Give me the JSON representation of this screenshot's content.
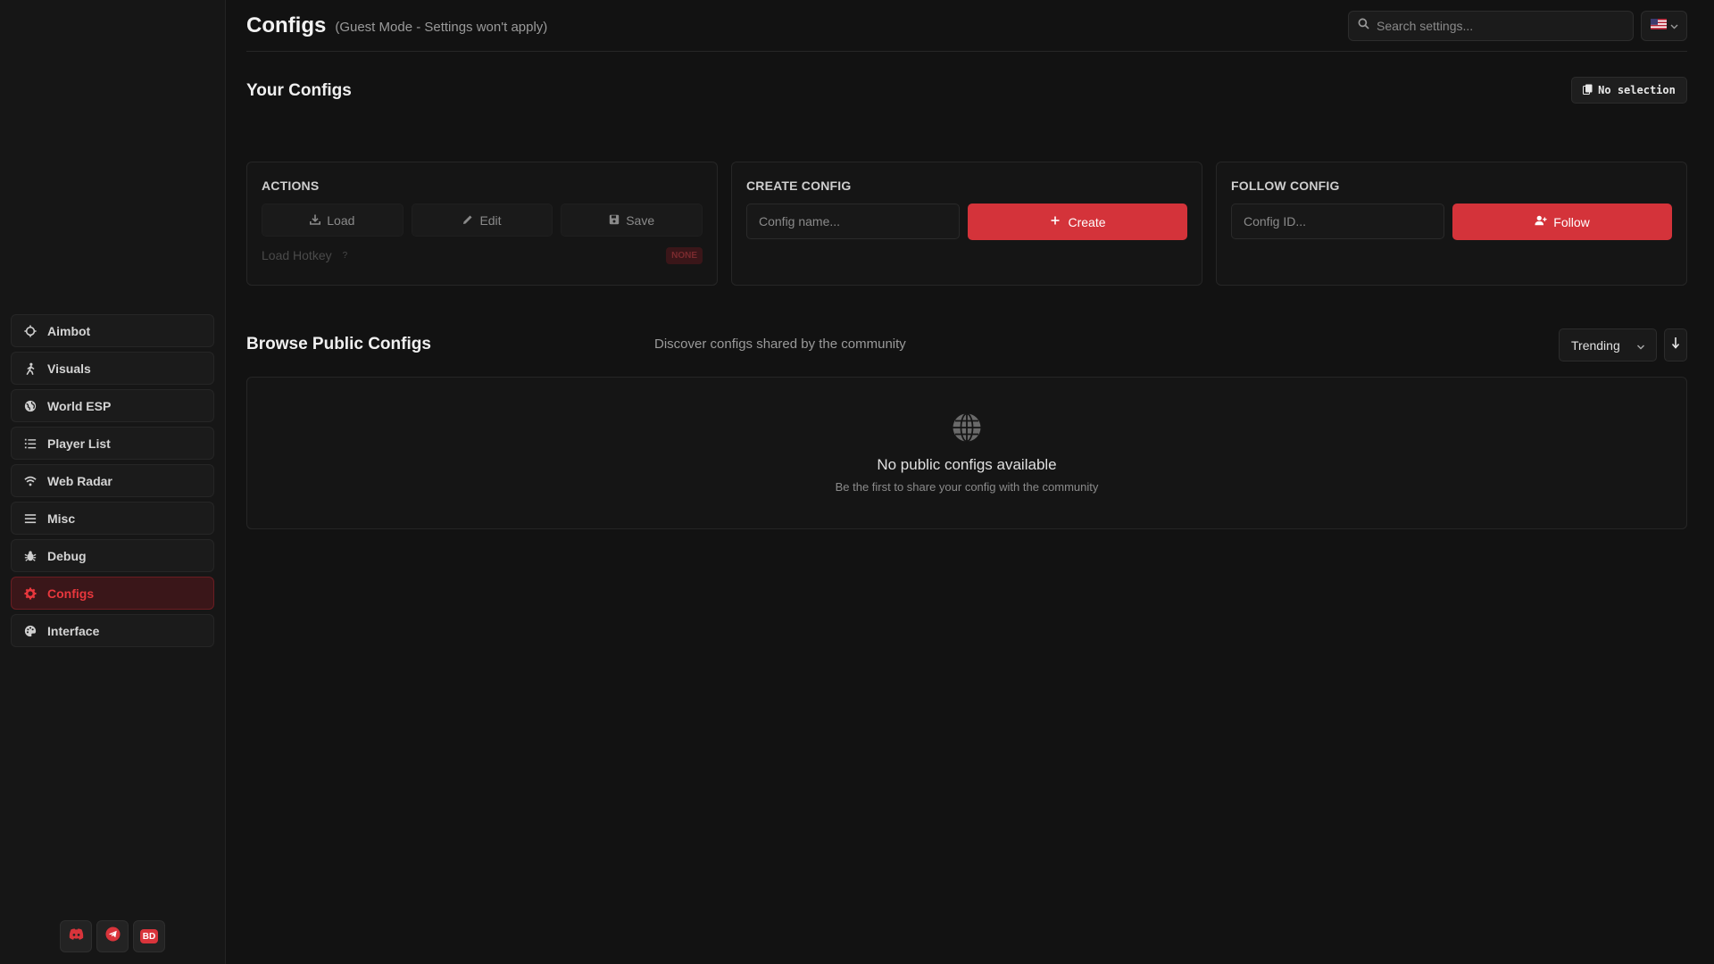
{
  "header": {
    "title": "Configs",
    "subtitle": "(Guest Mode - Settings won't apply)",
    "search_placeholder": "Search settings..."
  },
  "sidebar": {
    "items": [
      {
        "label": "Aimbot",
        "icon": "crosshair-icon",
        "active": false
      },
      {
        "label": "Visuals",
        "icon": "person-running-icon",
        "active": false
      },
      {
        "label": "World ESP",
        "icon": "globe-icon",
        "active": false
      },
      {
        "label": "Player List",
        "icon": "list-icon",
        "active": false
      },
      {
        "label": "Web Radar",
        "icon": "wifi-icon",
        "active": false
      },
      {
        "label": "Misc",
        "icon": "menu-icon",
        "active": false
      },
      {
        "label": "Debug",
        "icon": "bug-icon",
        "active": false
      },
      {
        "label": "Configs",
        "icon": "gear-icon",
        "active": true
      },
      {
        "label": "Interface",
        "icon": "palette-icon",
        "active": false
      }
    ],
    "social": {
      "bd_label": "BD"
    }
  },
  "your_configs": {
    "title": "Your Configs",
    "selection_label": "No selection"
  },
  "actions": {
    "title": "ACTIONS",
    "load": "Load",
    "edit": "Edit",
    "save": "Save",
    "hotkey_label": "Load Hotkey",
    "hotkey_help": "?",
    "hotkey_value": "NONE"
  },
  "create_config": {
    "title": "CREATE CONFIG",
    "placeholder": "Config name...",
    "button": "Create"
  },
  "follow_config": {
    "title": "FOLLOW CONFIG",
    "placeholder": "Config ID...",
    "button": "Follow"
  },
  "browse": {
    "title": "Browse Public Configs",
    "subtitle": "Discover configs shared by the community",
    "sort_value": "Trending",
    "empty_title": "No public configs available",
    "empty_subtitle": "Be the first to share your config with the community"
  },
  "colors": {
    "accent": "#d4333a",
    "background": "#121212",
    "sidebar": "#161616"
  }
}
